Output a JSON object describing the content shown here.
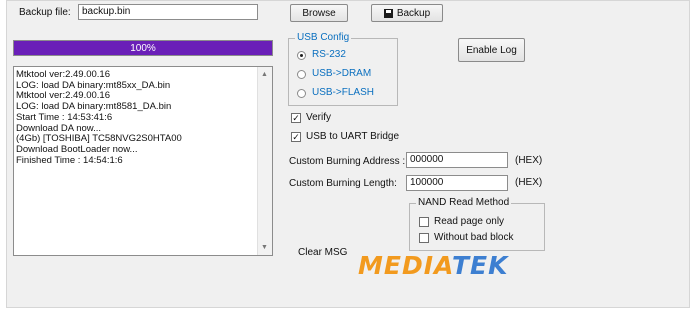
{
  "backup": {
    "file_label": "Backup file:",
    "file_value": "backup.bin",
    "browse_label": "Browse",
    "backup_button_label": "Backup"
  },
  "progress": {
    "percent": 100,
    "text": "100%",
    "color": "#6a1fb8"
  },
  "log": {
    "lines": [
      "Mtktool ver:2.49.00.16",
      "LOG: load DA binary:mt85xx_DA.bin",
      "Mtktool ver:2.49.00.16",
      "LOG: load DA binary:mt8581_DA.bin",
      "Start Time : 14:53:41:6",
      "Download DA now...",
      "(4Gb) [TOSHIBA] TC58NVG2S0HTA00",
      "Download BootLoader now...",
      "Finished Time : 14:54:1:6"
    ]
  },
  "usb_config": {
    "title": "USB Config",
    "options": [
      {
        "label": "RS-232",
        "selected": true
      },
      {
        "label": "USB->DRAM",
        "selected": false
      },
      {
        "label": "USB->FLASH",
        "selected": false
      }
    ]
  },
  "enable_log_label": "Enable Log",
  "verify": {
    "label": "Verify",
    "checked": true
  },
  "usb_uart": {
    "label": "USB to UART Bridge",
    "checked": true
  },
  "burning_address": {
    "label": "Custom Burning  Address :",
    "value": "000000",
    "unit": "(HEX)"
  },
  "burning_length": {
    "label": "Custom Burning  Length:",
    "value": "100000",
    "unit": "(HEX)"
  },
  "nand": {
    "title": "NAND Read Method",
    "read_page_only": {
      "label": "Read page only",
      "checked": false
    },
    "without_bad_block": {
      "label": "Without bad block",
      "checked": false
    }
  },
  "clear_msg_label": "Clear MSG",
  "logo": {
    "part1": "MEDIA",
    "part2": "TEK",
    "color1": "#f29a1e",
    "color2": "#3d7fd1"
  }
}
